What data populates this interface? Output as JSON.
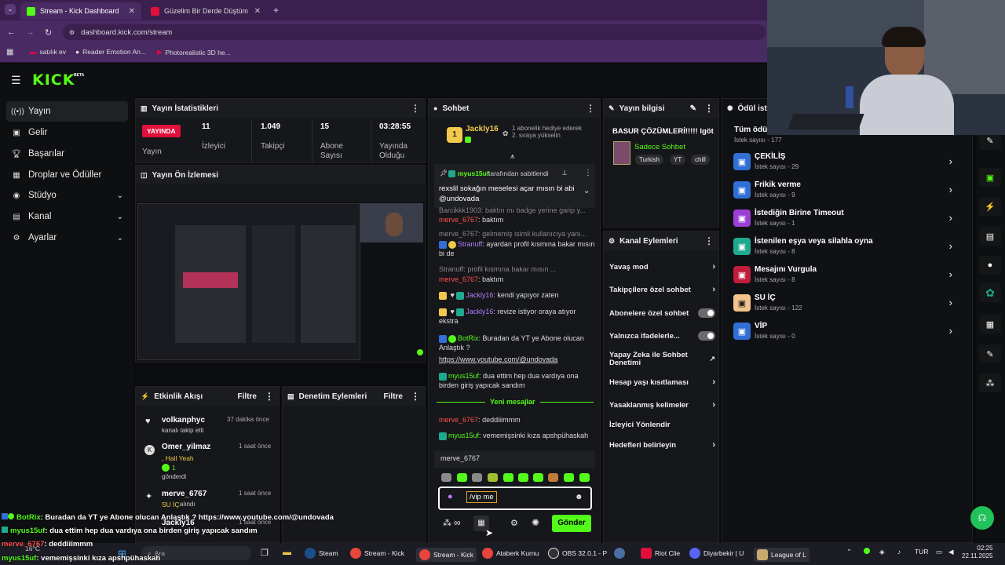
{
  "browser": {
    "tabs": [
      {
        "label": "Stream - Kick Dashboard"
      },
      {
        "label": "Güzelim Bir Derde Düştüm"
      }
    ],
    "url": "dashboard.kick.com/stream",
    "bookmarks": [
      "satılık ev",
      "Reader Emotion An...",
      "Photorealistic 3D he..."
    ]
  },
  "app": {
    "logo": "KICK",
    "beta": "BETA"
  },
  "sidebar": {
    "items": [
      {
        "label": "Yayın"
      },
      {
        "label": "Gelir"
      },
      {
        "label": "Başarılar"
      },
      {
        "label": "Droplar ve Ödüller"
      },
      {
        "label": "Stüdyo"
      },
      {
        "label": "Kanal"
      },
      {
        "label": "Ayarlar"
      }
    ]
  },
  "stats": {
    "title": "Yayın İstatistikleri",
    "live_badge": "YAYINDA",
    "items": [
      {
        "value": "11",
        "label": "İzleyici"
      },
      {
        "value": "1.049",
        "label": "Takipçi"
      },
      {
        "value": "15",
        "label": "Abone Sayısı"
      },
      {
        "value": "03:28:55",
        "label": "Yayında Olduğu"
      }
    ],
    "first_label": "Yayın"
  },
  "preview": {
    "title": "Yayın Ön İzlemesi"
  },
  "activity": {
    "title": "Etkinlik Akışı",
    "filter": "Filtre",
    "events": [
      {
        "user": "volkanphyc",
        "text": "kanalı takip etti",
        "time": "37 dakika önce"
      },
      {
        "user": "Omer_yilmaz",
        "text": ", Hail Yeah",
        "extra": "1",
        "extra2": "gönderdi",
        "time": "1 saat önce"
      },
      {
        "user": "merve_6767",
        "text": "SU İÇ",
        "extra2": "alındı",
        "time": "1 saat önce"
      },
      {
        "user": "Jackly16",
        "time": "1 saat önce"
      }
    ]
  },
  "moderation": {
    "title": "Denetim Eylemleri",
    "filter": "Filtre"
  },
  "chat": {
    "title": "Sohbet",
    "top_user": "Jackly16",
    "top_text": "1 abonelik hediye ederek 2. sıraya yükselin",
    "pinned_by": "myus15uf",
    "pinned_suffix": "tarafından sabitlendi",
    "pinned_text": "rexslil sokağın meselesi açar mısın bi abi @undovada",
    "messages": [
      {
        "user": "Barcikkk1903",
        "text": "baktın mı badge yerine garip y...",
        "faded": true
      },
      {
        "user": "merve_6767",
        "text": "baktım"
      },
      {
        "user": "merve_6767",
        "text": "gelmemiş isimli kullanıcıya yanı...",
        "faded": true
      },
      {
        "user": "Stranuff",
        "text": "ayardan profil kısmına bakar mısın bi de"
      },
      {
        "user": "Stranuff",
        "text": "profil kısmına bakar mısın ...",
        "faded": true
      },
      {
        "user": "merve_6767",
        "text": "baktım"
      },
      {
        "user": "Jackly16",
        "text": "kendi yapıyor zaten"
      },
      {
        "user": "Jackly16",
        "text": "revize istiyor oraya atıyor ekstra"
      },
      {
        "user": "BotRix",
        "text": "Buradan da YT ye Abone olucan Anlaştık ?"
      },
      {
        "link": "https://www.youtube.com/@undovada"
      },
      {
        "user": "myus15uf",
        "text": "dua ettim hep dua vardıya ona birden giriş yapıcak sandım"
      },
      {
        "user": "merve_6767",
        "text": "deddiiimmm"
      },
      {
        "user": "myus15uf",
        "text": "vememişsinki kıza apshpühaskah"
      }
    ],
    "new_messages": "Yeni mesajlar",
    "reply_to": "merve_6767",
    "input_value": "/vip me",
    "send": "Gönder"
  },
  "stream_info": {
    "title": "Yayın bilgisi",
    "stream_title": "BASUR ÇÖZÜMLERİ!!!!! lgöt",
    "category": "Sadece Sohbet",
    "tags": [
      "Turkish",
      "YT",
      "chill"
    ]
  },
  "channel_actions": {
    "title": "Kanal Eylemleri",
    "rows": [
      {
        "label": "Yavaş mod"
      },
      {
        "label": "Takipçilere özel sohbet"
      },
      {
        "label": "Abonelere özel sohbet"
      },
      {
        "label": "Yalnızca ifadelerle..."
      },
      {
        "label": "Yapay Zeka ile Sohbet Denetimi"
      },
      {
        "label": "Hesap yaşı kısıtlaması"
      },
      {
        "label": "Yasaklanmış kelimeler"
      },
      {
        "label": "İzleyici Yönlendir"
      },
      {
        "label": "Hedefleri belirleyin"
      }
    ]
  },
  "rewards": {
    "title": "Ödül iste",
    "all_label": "Tüm ödül",
    "all_count": "İstek sayısı - 177",
    "items": [
      {
        "name": "ÇEKİLİŞ",
        "count": "İstek sayısı - 29",
        "color": "#2f6fd6"
      },
      {
        "name": "Frikik verme",
        "count": "İstek sayısı - 9",
        "color": "#2f6fd6"
      },
      {
        "name": "İstediğin Birine Timeout",
        "count": "İstek sayısı - 1",
        "color": "#9b3fd6"
      },
      {
        "name": "İstenilen eşya veya silahla oyna",
        "count": "İstek sayısı - 8",
        "color": "#1fa98f"
      },
      {
        "name": "Mesajını Vurgula",
        "count": "İstek sayısı - 8",
        "color": "#c01c3c"
      },
      {
        "name": "SU İÇ",
        "count": "İstek sayısı - 122",
        "color": "#f2c48c"
      },
      {
        "name": "VİP",
        "count": "İstek sayısı - 0",
        "color": "#2f6fd6"
      }
    ]
  },
  "overlay_chat": [
    {
      "user": "BotRix",
      "text": ": Buradan da YT ye Abone olucan Anlaştık ? https://www.youtube.com/@undovada"
    },
    {
      "user": "myus15uf",
      "text": ": dua ettim hep dua vardıya ona birden giriş yapıcak sandım"
    },
    {
      "user": "merve_6767",
      "text": ": deddiiimmm"
    },
    {
      "user": "myus15uf",
      "text": ": vememişsinki kıza apshpühaskah"
    }
  ],
  "taskbar": {
    "items": [
      "Steam",
      "Stream - Kick",
      "Stream - Kick",
      "Ataberk Kurnu",
      "OBS 32.0.1 - P",
      "Riot Clie",
      "Diyarbekir | U",
      "League of L"
    ],
    "weather": "16°C",
    "search": "Ara",
    "lang": "TUR",
    "time": "02:25",
    "date": "22.11.2025"
  },
  "colors": {
    "accent": "#53fc18",
    "live": "#e0103a"
  }
}
